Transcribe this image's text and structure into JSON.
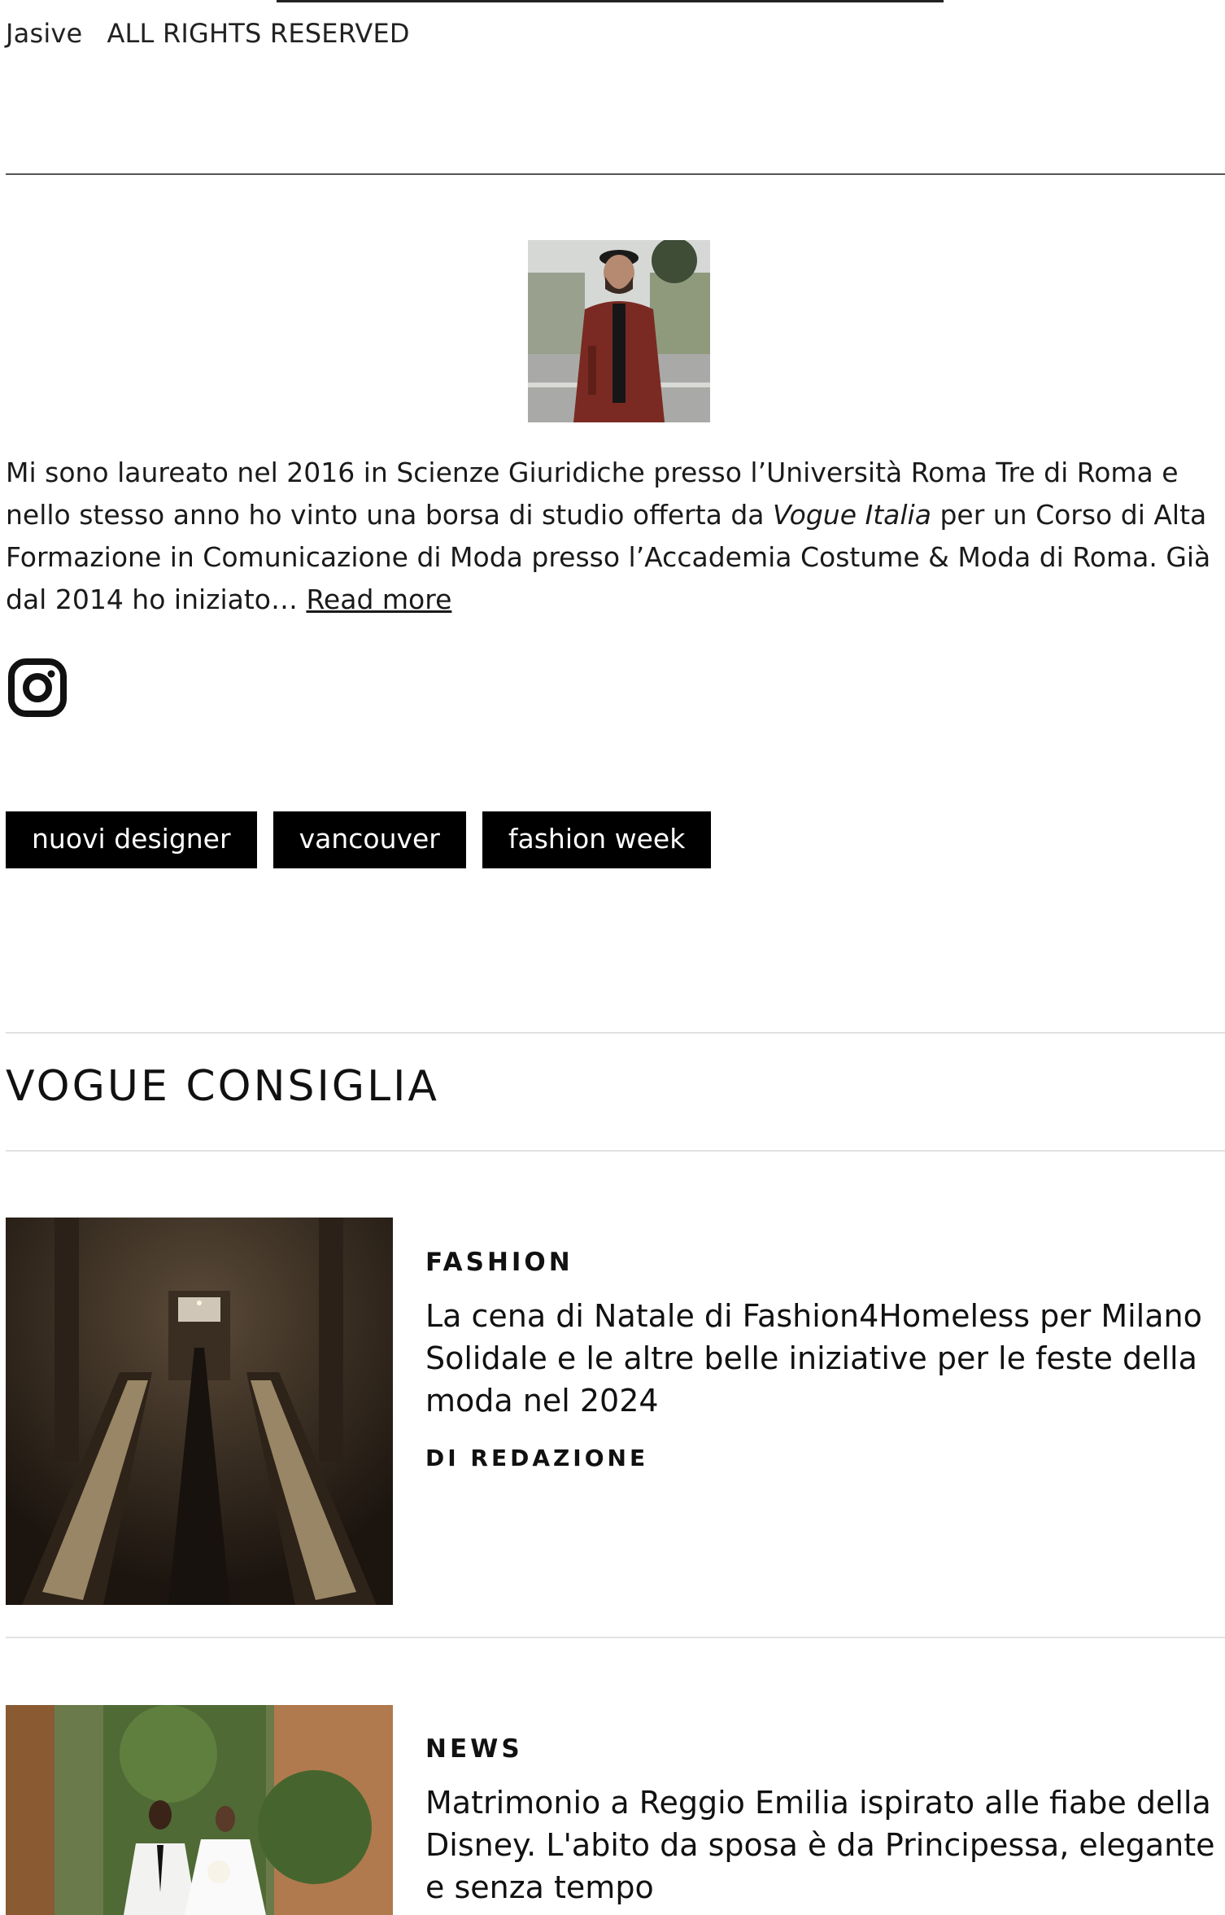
{
  "credit": {
    "brand": "Jasive",
    "rights": "ALL RIGHTS RESERVED"
  },
  "author": {
    "bio_text": "Mi sono laureato nel 2016 in Scienze Giuridiche presso l’Università Roma Tre di Roma e nello stesso anno ho vinto una borsa di studio offerta da ",
    "bio_emphasis": "Vogue Italia",
    "bio_text_2": " per un Corso di Alta Formazione in Comunicazione di Moda presso l’Accademia Costume & Moda di Roma. Già dal 2014 ho iniziato… ",
    "read_more": "Read more",
    "social_icon": "instagram-icon"
  },
  "tags": [
    "nuovi designer",
    "vancouver",
    "fashion week"
  ],
  "section": {
    "title": "VOGUE CONSIGLIA"
  },
  "articles": [
    {
      "kicker": "FASHION",
      "headline": "La cena di Natale di Fashion4Homeless per Milano Solidale e le altre belle iniziative per le feste della moda nel 2024",
      "byline": "DI REDAZIONE"
    },
    {
      "kicker": "NEWS",
      "headline": "Matrimonio a Reggio Emilia ispirato alle fiabe della Disney. L'abito da sposa è da Principessa, elegante e senza tempo"
    }
  ]
}
